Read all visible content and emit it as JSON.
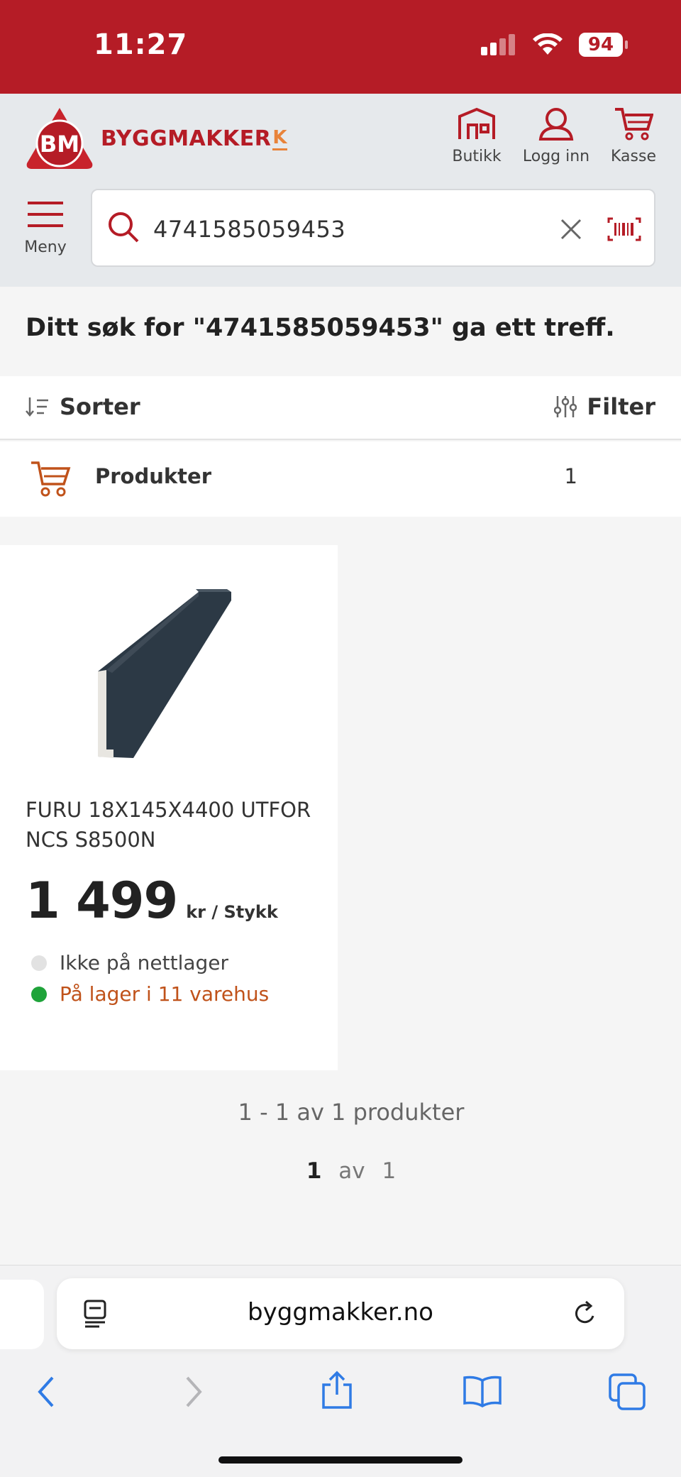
{
  "status_bar": {
    "time": "11:27",
    "battery": "94"
  },
  "header": {
    "logo_badge": "BM",
    "logo_name": "BYGGMAKKER",
    "logo_k": "K",
    "actions": [
      {
        "label": "Butikk"
      },
      {
        "label": "Logg inn"
      },
      {
        "label": "Kasse"
      }
    ],
    "menu_label": "Meny"
  },
  "search": {
    "value": "4741585059453"
  },
  "result": {
    "title": "Ditt søk for \"4741585059453\" ga ett treff."
  },
  "toolbar": {
    "sort_label": "Sorter",
    "filter_label": "Filter"
  },
  "products_tab": {
    "label": "Produkter",
    "count": "1"
  },
  "product": {
    "name_line1": "FURU 18X145X4400 UTFOR",
    "name_line2": "NCS S8500N",
    "price": "1 499",
    "unit": "kr / Stykk",
    "stock": [
      {
        "text": "Ikke på nettlager",
        "color": "#e2e2e2",
        "text_color": "#444444"
      },
      {
        "text": "På lager i 11 varehus",
        "color": "#1fa33a",
        "text_color": "#c0521a"
      }
    ]
  },
  "pagination": {
    "summary": "1 - 1 av 1 produkter",
    "current": "1",
    "sep": "av",
    "total": "1"
  },
  "browser": {
    "url": "byggmakker.no"
  },
  "colors": {
    "brand": "#b51c26",
    "accent": "#e8833a"
  }
}
